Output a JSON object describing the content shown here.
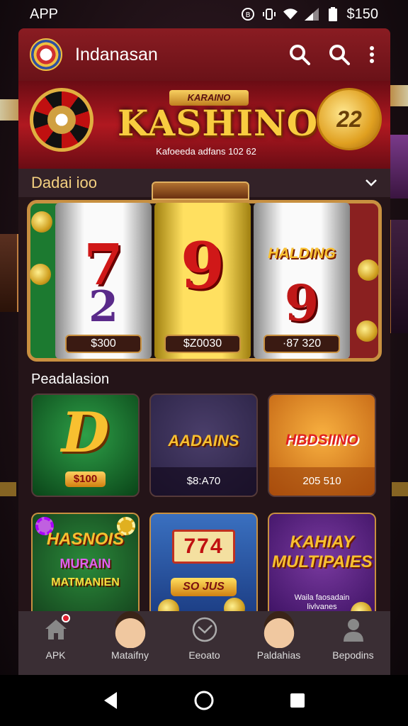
{
  "status_bar": {
    "left_label": "APP",
    "right_label": "$150"
  },
  "header": {
    "title": "Indanasan"
  },
  "banner": {
    "small_title": "KARAINO",
    "title": "KASHINO",
    "subtitle": "Kafoeeda adfans 102 62",
    "coin_value": "22"
  },
  "featured": {
    "title": "Dadai ioo",
    "reels": [
      {
        "amount": "$300",
        "symbols": [
          "7",
          "2"
        ]
      },
      {
        "amount": "$Z0030",
        "symbols": [
          "9"
        ]
      },
      {
        "amount": "·87 320",
        "logo": "HALDING",
        "symbols": [
          "9"
        ]
      }
    ]
  },
  "promo": {
    "label": "Peadalasion",
    "tiles": [
      {
        "big": "D",
        "pill": "$100"
      },
      {
        "name": "AADAINS",
        "bar": "$8:A70"
      },
      {
        "name": "HBDSIINO",
        "bar": "205 510"
      }
    ]
  },
  "games": [
    {
      "title": "HASNOIS",
      "line1": "MURAIN",
      "line2": "MATMANIEN"
    },
    {
      "reels": "774",
      "pill": "SO JUS"
    },
    {
      "title": "KAHIAY MULTIPAIES",
      "small": "Waila faosadain\nlivlvanes"
    }
  ],
  "bottom_nav": {
    "items": [
      {
        "label": "APK",
        "icon": "home-icon"
      },
      {
        "label": "Mataifny",
        "icon": "avatar-icon"
      },
      {
        "label": "Eeoato",
        "icon": "clock-icon"
      },
      {
        "label": "Paldahias",
        "icon": "avatar-icon"
      },
      {
        "label": "Bepodins",
        "icon": "profile-icon"
      }
    ]
  }
}
